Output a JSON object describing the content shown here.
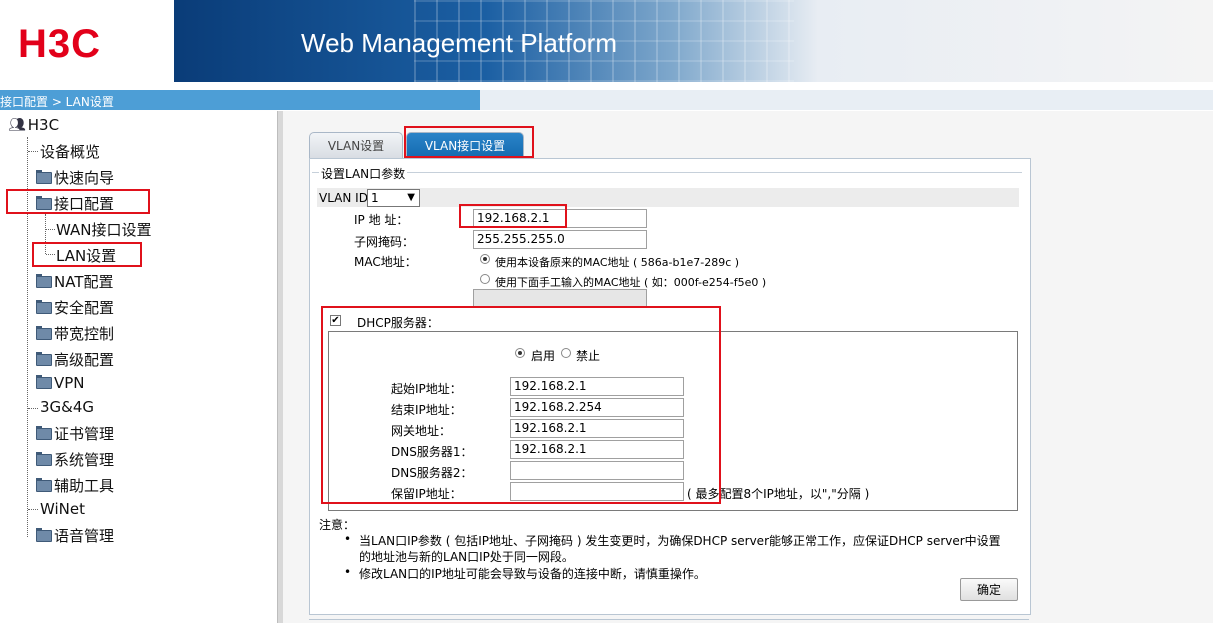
{
  "header": {
    "logo": "H3C",
    "title": "Web Management Platform"
  },
  "breadcrumb": "接口配置 > LAN设置",
  "sidebar": {
    "root": "H3C",
    "items": [
      {
        "label": "设备概览",
        "folder": false
      },
      {
        "label": "快速向导",
        "folder": true
      },
      {
        "label": "接口配置",
        "folder": true
      },
      {
        "label": "WAN接口设置",
        "folder": false
      },
      {
        "label": "LAN设置",
        "folder": false
      },
      {
        "label": "NAT配置",
        "folder": true
      },
      {
        "label": "安全配置",
        "folder": true
      },
      {
        "label": "带宽控制",
        "folder": true
      },
      {
        "label": "高级配置",
        "folder": true
      },
      {
        "label": "VPN",
        "folder": true
      },
      {
        "label": "3G&4G",
        "folder": false
      },
      {
        "label": "证书管理",
        "folder": true
      },
      {
        "label": "系统管理",
        "folder": true
      },
      {
        "label": "辅助工具",
        "folder": true
      },
      {
        "label": "WiNet",
        "folder": false
      },
      {
        "label": "语音管理",
        "folder": true
      }
    ]
  },
  "tabs": [
    {
      "label": "VLAN设置",
      "active": false
    },
    {
      "label": "VLAN接口设置",
      "active": true
    }
  ],
  "form": {
    "legend": "设置LAN口参数",
    "vlan_id_label": "VLAN ID",
    "vlan_id_value": "1",
    "ip_label": "IP 地 址：",
    "ip_value": "192.168.2.1",
    "mask_label": "子网掩码：",
    "mask_value": "255.255.255.0",
    "mac_label": "MAC地址：",
    "mac_option_1": "使用本设备原来的MAC地址 ( 586a-b1e7-289c )",
    "mac_option_2": "使用下面手工输入的MAC地址 ( 如：000f-e254-f5e0 )",
    "mac_input": ""
  },
  "dhcp": {
    "label": "DHCP服务器：",
    "enabled_checkbox": true,
    "enable_label": "启用",
    "disable_label": "禁止",
    "start_ip_label": "起始IP地址：",
    "start_ip": "192.168.2.1",
    "end_ip_label": "结束IP地址：",
    "end_ip": "192.168.2.254",
    "gateway_label": "网关地址：",
    "gateway": "192.168.2.1",
    "dns1_label": "DNS服务器1：",
    "dns1": "192.168.2.1",
    "dns2_label": "DNS服务器2：",
    "dns2": "",
    "reserved_label": "保留IP地址：",
    "reserved": "",
    "reserved_hint": "( 最多配置8个IP地址，以\",\"分隔 )"
  },
  "notes": {
    "title": "注意：",
    "line1": "当LAN口IP参数 ( 包括IP地址、子网掩码 ) 发生变更时，为确保DHCP server能够正常工作，应保证DHCP server中设置",
    "line1b": "的地址池与新的LAN口IP处于同一网段。",
    "line2": "修改LAN口的IP地址可能会导致与设备的连接中断，请慎重操作。"
  },
  "ok_button": "确定",
  "colors": {
    "accent": "#146bb0",
    "highlight": "#e0111b",
    "logo": "#e2001a"
  }
}
